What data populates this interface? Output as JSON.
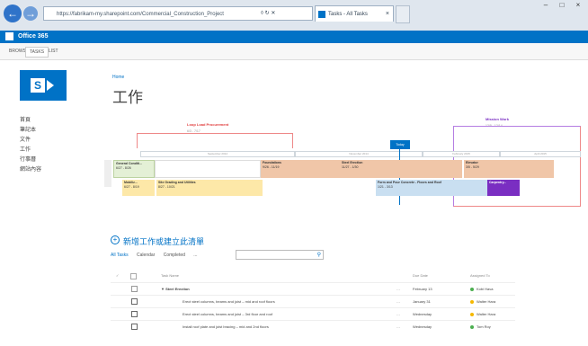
{
  "browser": {
    "address": "https://fabrikam-my.sharepoint.com/Commercial_Construction_Project",
    "tab_title": "Tasks - All Tasks"
  },
  "suite": {
    "name": "Office 365"
  },
  "ribbon": {
    "tabs": [
      "BROWSE",
      "TASKS",
      "LIST"
    ]
  },
  "page": {
    "breadcrumb": "Home",
    "title": "工作"
  },
  "quicklaunch": [
    "首頁",
    "筆記本",
    "文件",
    "工作",
    "行事曆",
    "網站內容"
  ],
  "timeline": {
    "milestones": [
      {
        "label": "Loop Load Procurement",
        "date": "6/3 - 7/17",
        "color": "#e03c3c"
      },
      {
        "label": "Mission Work",
        "date": "12/5 - 12/14",
        "color": "#7a2ec2"
      }
    ],
    "months": [
      "September 2014",
      "November 2014",
      "February 2015",
      "April 2015"
    ],
    "today_label": "Today",
    "bars": [
      {
        "label": "General Conditi...",
        "date": "6/27 - 8/26"
      },
      {
        "label": "Foundations",
        "date": "9/26 - 11/19"
      },
      {
        "label": "Steel Erection",
        "date": "11/27 - 1/30"
      },
      {
        "label": "Elevator",
        "date": "3/5 - 5/29"
      },
      {
        "label": "Mobiliz...",
        "date": "6/27 - 8/19"
      },
      {
        "label": "Site Grading and Utilities",
        "date": "8/27 - 10/21"
      },
      {
        "label": "Form and Pour Concrete - Floors and Roof",
        "date": "1/21 - 3/13"
      },
      {
        "label": "Carpentry...",
        "date": ""
      }
    ]
  },
  "tasklist": {
    "title": "新增工作或建立此清單",
    "views": [
      "All Tasks",
      "Calendar",
      "Completed",
      "..."
    ],
    "search_placeholder": "",
    "columns": {
      "name": "Task Name",
      "due": "Due Date",
      "assigned": "Assigned To"
    },
    "rows": [
      {
        "name": "Steel Erection",
        "due": "February 13",
        "assigned": "Kobi Hava",
        "dot": "#4caf50",
        "checked": false
      },
      {
        "name": "Erect steel columns, beams and joist – mid and roof floors",
        "due": "January 31",
        "assigned": "Walter Hara",
        "dot": "#f5b800",
        "checked": true
      },
      {
        "name": "Erect steel columns, beams and joist – 3rd floor and roof",
        "due": "Wednesday",
        "assigned": "Walter Hara",
        "dot": "#f5b800",
        "checked": true
      },
      {
        "name": "Install roof plate and joist bracing – mid and 2nd floors",
        "due": "Wednesday",
        "assigned": "Tom Roy",
        "dot": "#4caf50",
        "checked": true
      }
    ]
  }
}
